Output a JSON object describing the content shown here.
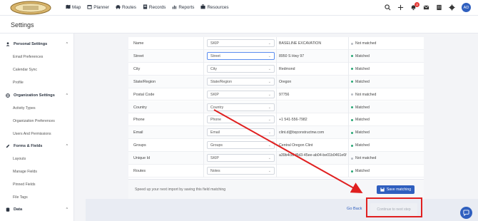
{
  "app": {
    "logo_name": "company-logo",
    "nav": [
      {
        "label": "Map",
        "icon": "map-icon"
      },
      {
        "label": "Planner",
        "icon": "calendar-icon"
      },
      {
        "label": "Routes",
        "icon": "car-icon"
      },
      {
        "label": "Records",
        "icon": "records-icon"
      },
      {
        "label": "Reports",
        "icon": "chart-icon"
      },
      {
        "label": "Resources",
        "icon": "briefcase-icon"
      }
    ],
    "notification_count": "3",
    "avatar_initials": "AD"
  },
  "page_title": "Settings",
  "sidebar": {
    "sections": [
      {
        "label": "Personal Settings",
        "icon": "user-icon",
        "items": [
          "Email Preferences",
          "Calendar Sync",
          "Profile"
        ]
      },
      {
        "label": "Organization Settings",
        "icon": "globe-icon",
        "items": [
          "Activity Types",
          "Organization Preferences",
          "Users And Permissions"
        ]
      },
      {
        "label": "Forms & Fields",
        "icon": "pencil-icon",
        "items": [
          "Layouts",
          "Manage Fields",
          "Pinned Fields",
          "File Tags"
        ]
      },
      {
        "label": "Data",
        "icon": "database-icon",
        "items": []
      }
    ]
  },
  "mapping": {
    "rows": [
      {
        "field": "Name",
        "select": "SKIP",
        "sample": "BASELINE EXCAVATION",
        "status": "Not matched",
        "matched": false
      },
      {
        "field": "Street",
        "select": "Street",
        "sample": "8950 S Hwy 97",
        "status": "Matched",
        "matched": true
      },
      {
        "field": "City",
        "select": "City",
        "sample": "Redmond",
        "status": "Matched",
        "matched": true
      },
      {
        "field": "State/Region",
        "select": "State/Region",
        "sample": "Oregon",
        "status": "Matched",
        "matched": true
      },
      {
        "field": "Postal Code",
        "select": "SKIP",
        "sample": "97756",
        "status": "Not matched",
        "matched": false
      },
      {
        "field": "Country",
        "select": "Country",
        "sample": "",
        "status": "Matched",
        "matched": true
      },
      {
        "field": "Phone",
        "select": "Phone",
        "sample": "+1 541-556-7982",
        "status": "Matched",
        "matched": true
      },
      {
        "field": "Email",
        "select": "Email",
        "sample": "clint.d@bqconstructnw.com",
        "status": "Matched",
        "matched": true
      },
      {
        "field": "Groups",
        "select": "Groups",
        "sample": "Central Oregon Clint",
        "status": "Matched",
        "matched": true
      },
      {
        "field": "Unique Id",
        "select": "SKIP",
        "sample": "a39b4c8f-f6d3-45ee-ab04-be01b0461e6f",
        "status": "Not matched",
        "matched": false
      },
      {
        "field": "Routes",
        "select": "Notes",
        "sample": "",
        "status": "Matched",
        "matched": true
      }
    ],
    "save_hint": "Speed up your next import by saving this field matching",
    "save_label": "Save matching"
  },
  "footer": {
    "back_label": "Go Back",
    "continue_label": "Continue to next step"
  },
  "colors": {
    "accent": "#2f5fbf",
    "matched": "#2aa876",
    "highlight": "#e02020"
  }
}
